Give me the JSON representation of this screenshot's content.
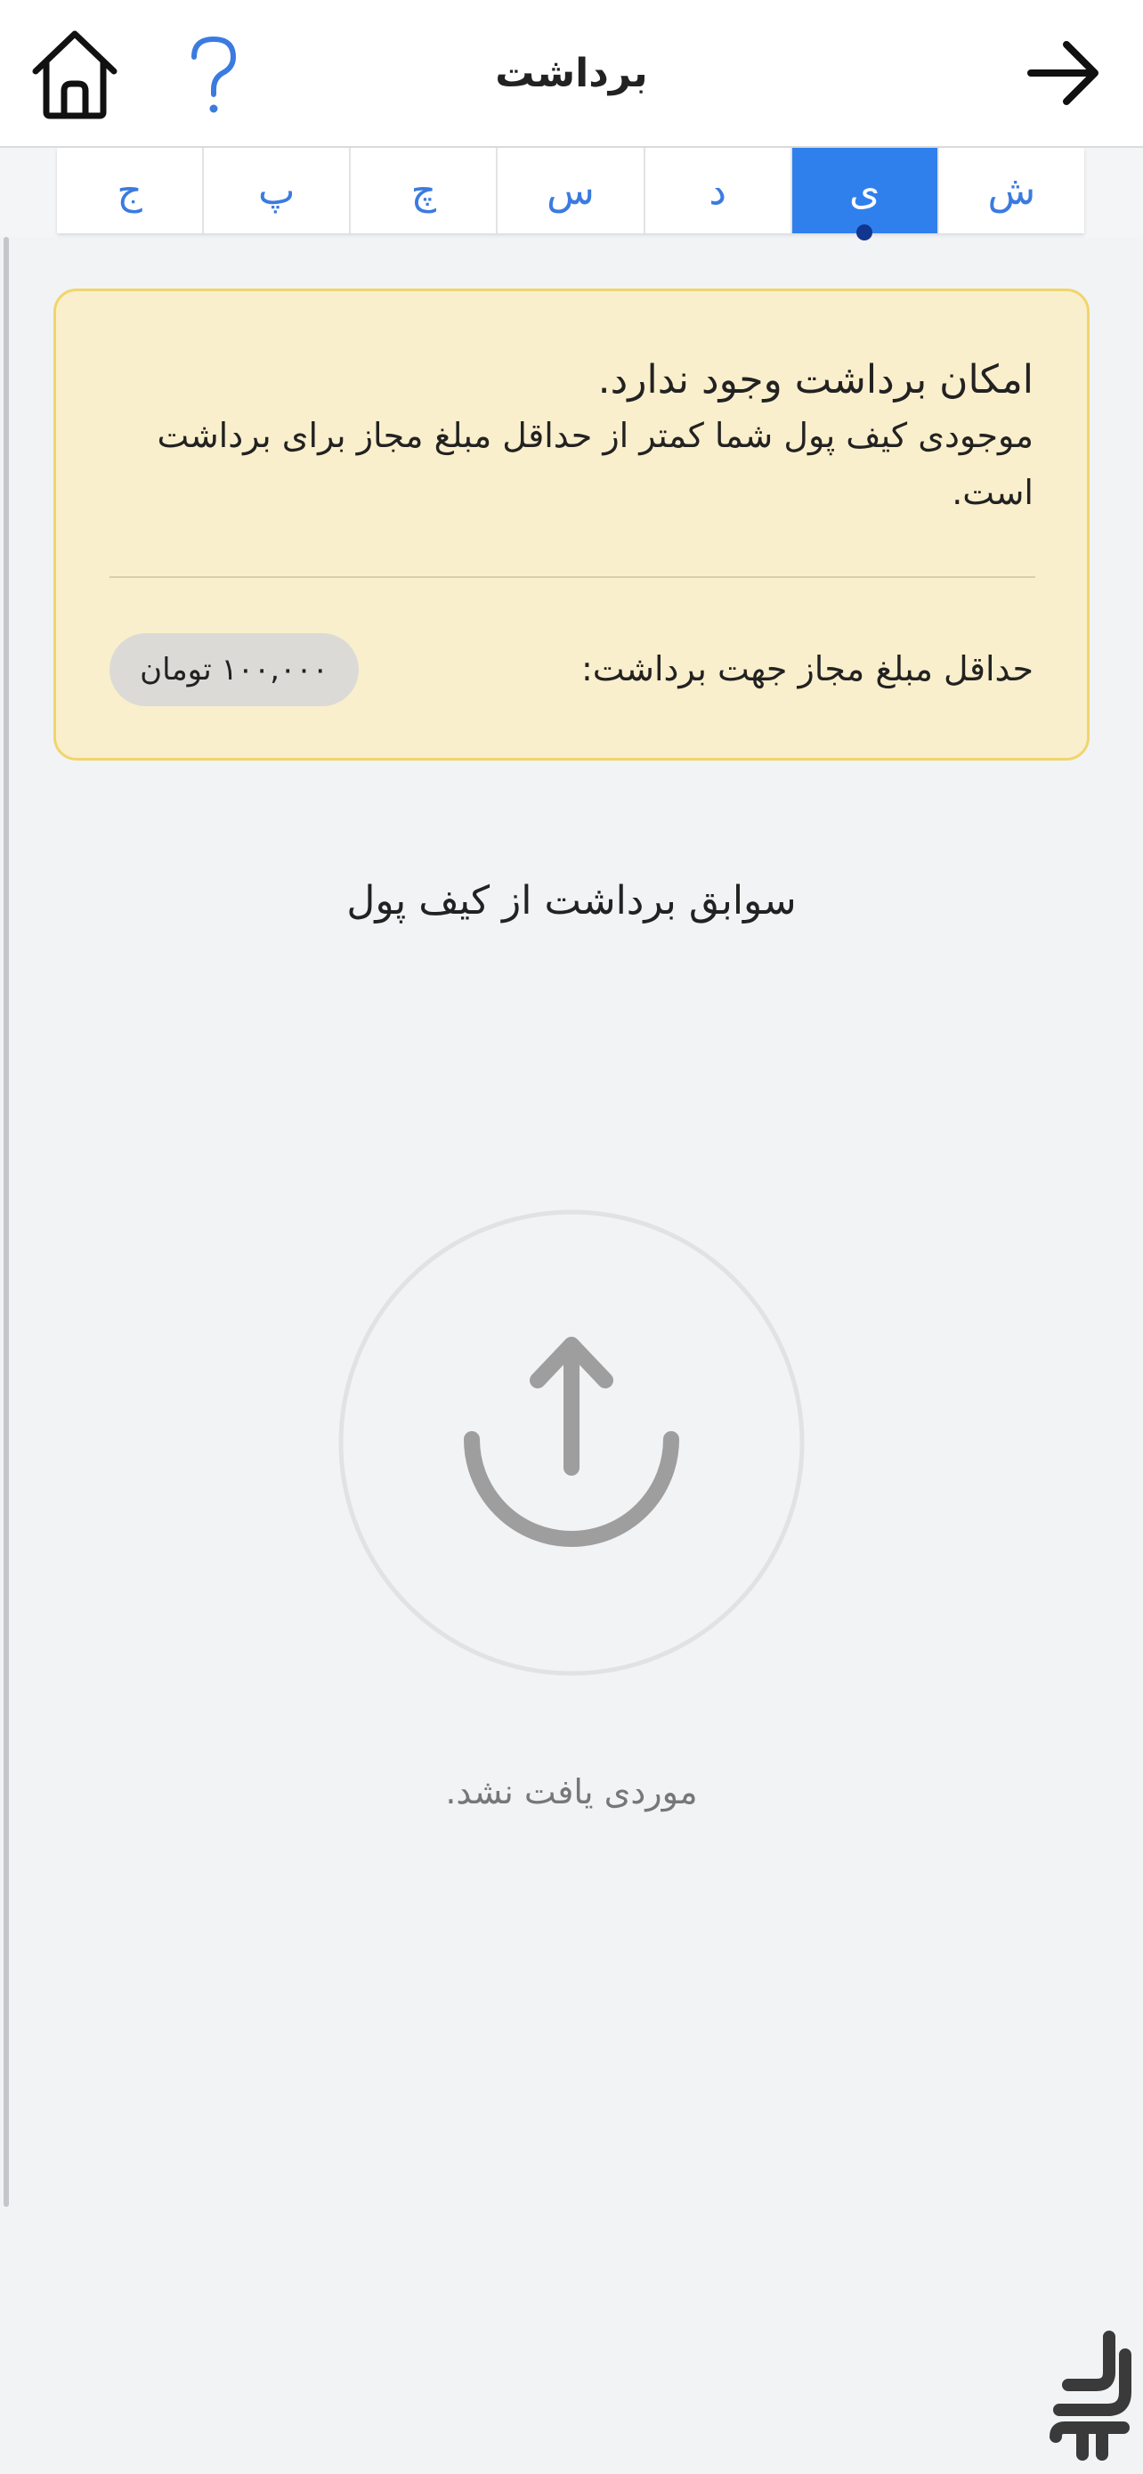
{
  "header": {
    "title": "برداشت",
    "home_icon": "home-icon",
    "help_icon": "question-mark-icon",
    "back_icon": "arrow-right-icon"
  },
  "tabs": [
    {
      "label": "ش",
      "active": false
    },
    {
      "label": "ی",
      "active": true
    },
    {
      "label": "د",
      "active": false
    },
    {
      "label": "س",
      "active": false
    },
    {
      "label": "چ",
      "active": false
    },
    {
      "label": "پ",
      "active": false
    },
    {
      "label": "ج",
      "active": false
    }
  ],
  "warning": {
    "title": "امکان برداشت وجود ندارد.",
    "message": "موجودی کیف پول شما کمتر از حداقل مبلغ مجاز برای برداشت است.",
    "min_label": "حداقل مبلغ مجاز جهت برداشت:",
    "min_amount": "۱۰۰,۰۰۰ تومان"
  },
  "history": {
    "title": "سوابق برداشت از کیف پول",
    "empty_icon": "upload-icon",
    "empty_text": "موردی یافت نشد."
  },
  "colors": {
    "accent": "#2f80ed",
    "active_dot": "#12358f",
    "warning_bg": "#faefcc",
    "warning_border": "#f0d56d",
    "page_bg": "#f2f3f5"
  }
}
